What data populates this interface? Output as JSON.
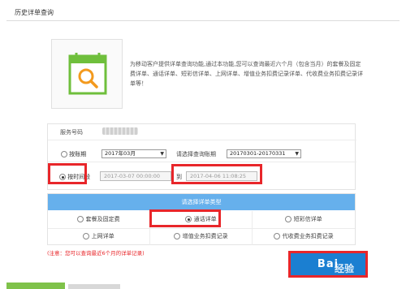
{
  "page_title": "历史详单查询",
  "intro_text": "为移动客户提供详单查询功能,通过本功能,您可以查询最近六个月（包含当月）的套餐及固定费详单、通话详单、短彩信详单、上网详单、增值业务扣费记录详单、代收费业务扣费记录详单等！",
  "form": {
    "service_label": "服务号码",
    "by_period_label": "按账期",
    "month_value": "2017年03月",
    "period_prompt": "请选择查询账期",
    "period_value": "20170301-20170331",
    "by_time_label": "按时间段",
    "start_value": "2017-03-07 00:00:00",
    "to_label": "到",
    "end_value": "2017-04-06 11:08:25"
  },
  "types": {
    "header": "请选择详单类型",
    "items": [
      "套餐及固定费",
      "通话详单",
      "短彩信详单",
      "上网详单",
      "增值业务扣费记录",
      "代收费业务扣费记录"
    ],
    "selected": "通话详单"
  },
  "note": "(注意：您可以查询最近6个月的详单记录)",
  "submit_label": "Bai",
  "watermark": "经验",
  "colors": {
    "accent_blue": "#1b7fd1",
    "header_blue": "#66b0ec",
    "highlight_red": "#e8262a"
  }
}
